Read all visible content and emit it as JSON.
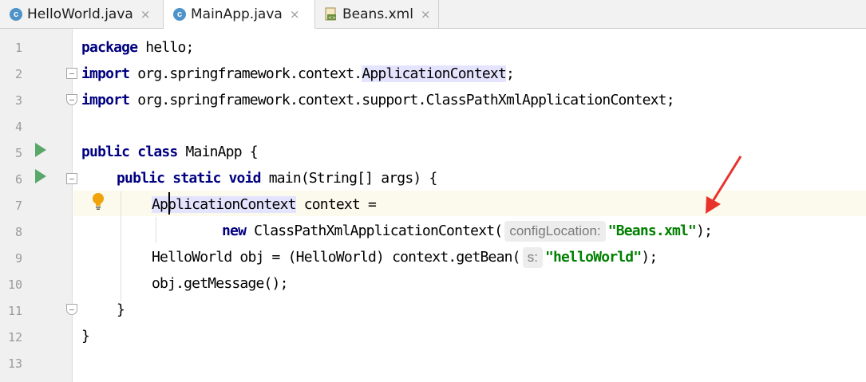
{
  "tabs": [
    {
      "label": "HelloWorld.java",
      "icon": "java-class-icon",
      "active": false
    },
    {
      "label": "MainApp.java",
      "icon": "java-class-icon",
      "active": true
    },
    {
      "label": "Beans.xml",
      "icon": "xml-file-icon",
      "active": false
    }
  ],
  "tab_close_glyph": "×",
  "class_icon_letter": "c",
  "line_numbers": [
    "1",
    "2",
    "3",
    "4",
    "5",
    "6",
    "7",
    "8",
    "9",
    "10",
    "11",
    "12",
    "13"
  ],
  "code": {
    "l1_kw": "package",
    "l1_rest": " hello;",
    "l2_kw": "import",
    "l2_pkg": " org.springframework.context.",
    "l2_cls": "ApplicationContext",
    "l2_end": ";",
    "l3_kw": "import",
    "l3_rest": " org.springframework.context.support.ClassPathXmlApplicationContext;",
    "l5_kw": "public class",
    "l5_rest": " MainApp {",
    "l6_kw": "public static void",
    "l6_rest": " main(String[] args) {",
    "l7_cls": "ApplicationContext",
    "l7_rest": " context =",
    "l8_kw": "new",
    "l8_mid": " ClassPathXmlApplicationContext(",
    "l8_hint": "configLocation:",
    "l8_str": "\"Beans.xml\"",
    "l8_end": ");",
    "l9_mid": "HelloWorld obj = (HelloWorld) context.getBean(",
    "l9_hint": "s:",
    "l9_str": "\"helloWorld\"",
    "l9_end": ");",
    "l10": "obj.getMessage();",
    "l11": "}",
    "l12": "}"
  },
  "colors": {
    "keyword": "#000080",
    "string": "#008000",
    "annotation_arrow": "#e8322c",
    "run_icon": "#59a869"
  }
}
